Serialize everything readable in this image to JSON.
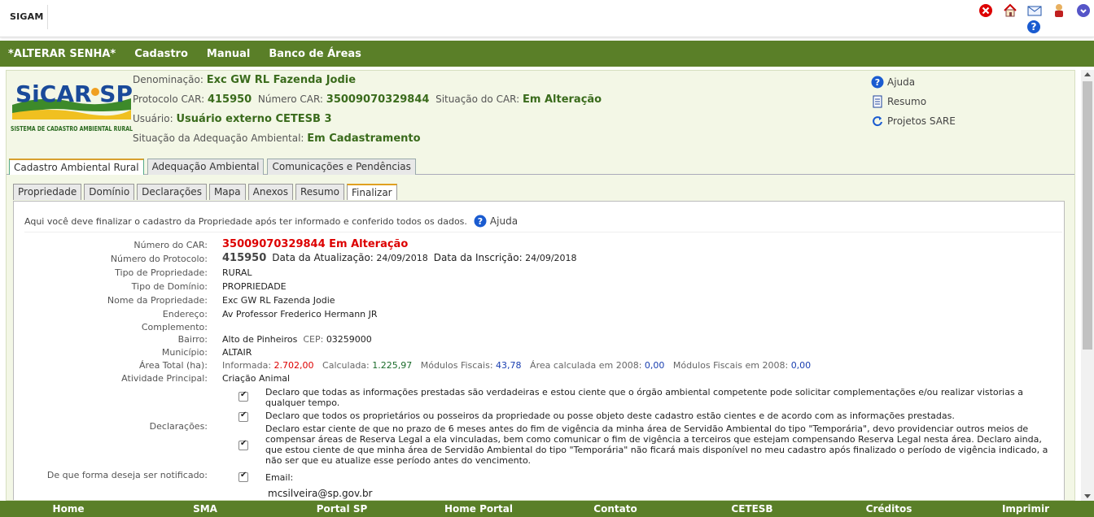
{
  "app": {
    "brand": "SIGAM"
  },
  "colors": {
    "nav_green": "#5a7f28",
    "value_green": "#3a6b1c",
    "alert_red": "#d00000",
    "link_blue": "#1a3fb0"
  },
  "top_icons": [
    {
      "name": "close-icon",
      "color": "#d00"
    },
    {
      "name": "home-icon",
      "color": "#c00"
    },
    {
      "name": "mail-icon",
      "color": "#2255aa"
    },
    {
      "name": "user-icon",
      "color": "#d08000"
    },
    {
      "name": "power-icon",
      "color": "#3a3aa0"
    }
  ],
  "mainnav": {
    "items": [
      "*ALTERAR SENHA*",
      "Cadastro",
      "Manual",
      "Banco de Áreas"
    ]
  },
  "header": {
    "logo_title": "SiCAR SP",
    "logo_subtitle": "SISTEMA DE CADASTRO AMBIENTAL RURAL",
    "denominacao_label": "Denominação:",
    "denominacao_value": "Exc GW RL Fazenda Jodie",
    "protocolo_label": "Protocolo CAR:",
    "protocolo_value": "415950",
    "numero_car_label": "Número CAR:",
    "numero_car_value": "35009070329844",
    "situacao_car_label": "Situação do CAR:",
    "situacao_car_value": "Em Alteração",
    "usuario_label": "Usuário:",
    "usuario_value": "Usuário externo CETESB 3",
    "adequacao_label": "Situação da Adequação Ambiental:",
    "adequacao_value": "Em Cadastramento"
  },
  "sidelinks": {
    "ajuda": "Ajuda",
    "resumo": "Resumo",
    "projetos": "Projetos SARE"
  },
  "outer_tabs": [
    "Cadastro Ambiental Rural",
    "Adequação Ambiental",
    "Comunicações e Pendências"
  ],
  "inner_tabs": [
    "Propriedade",
    "Domínio",
    "Declarações",
    "Mapa",
    "Anexos",
    "Resumo",
    "Finalizar"
  ],
  "intro": {
    "text": "Aqui você deve finalizar o cadastro da Propriedade após ter informado e conferido todos os dados.",
    "help": "Ajuda"
  },
  "details": {
    "numero_car_label": "Número do CAR:",
    "numero_car_value": "35009070329844 Em Alteração",
    "protocolo_label": "Número do Protocolo:",
    "protocolo_value": "415950",
    "data_atualizacao_label": "Data da Atualização:",
    "data_atualizacao_value": "24/09/2018",
    "data_inscricao_label": "Data da Inscrição:",
    "data_inscricao_value": "24/09/2018",
    "tipo_propriedade_label": "Tipo de Propriedade:",
    "tipo_propriedade_value": "RURAL",
    "tipo_dominio_label": "Tipo de Domínio:",
    "tipo_dominio_value": "PROPRIEDADE",
    "nome_label": "Nome da Propriedade:",
    "nome_value": "Exc GW RL Fazenda Jodie",
    "endereco_label": "Endereço:",
    "endereco_value": "Av Professor Frederico Hermann JR",
    "complemento_label": "Complemento:",
    "bairro_label": "Bairro:",
    "bairro_value": "Alto de Pinheiros",
    "cep_label": "CEP:",
    "cep_value": "03259000",
    "municipio_label": "Município:",
    "municipio_value": "ALTAIR",
    "area_label": "Área Total (ha):",
    "informada_label": "Informada:",
    "informada_value": "2.702,00",
    "calculada_label": "Calculada:",
    "calculada_value": "1.225,97",
    "modulos_label": "Módulos Fiscais:",
    "modulos_value": "43,78",
    "area2008_label": "Área calculada em 2008:",
    "area2008_value": "0,00",
    "modulos2008_label": "Módulos Fiscais em 2008:",
    "modulos2008_value": "0,00",
    "atividade_label": "Atividade Principal:",
    "atividade_value": "Criação Animal"
  },
  "declaracoes": {
    "label": "Declarações:",
    "items": [
      "Declaro que todas as informações prestadas são verdadeiras e estou ciente que o órgão ambiental competente pode solicitar complementações e/ou realizar vistorias a qualquer tempo.",
      "Declaro que todos os proprietários ou posseiros da propriedade ou posse objeto deste cadastro estão cientes e de acordo com as informações prestadas.",
      "Declaro estar ciente de que no prazo de 6 meses antes do fim de vigência da minha área de Servidão Ambiental do tipo \"Temporária\", devo providenciar outros meios de compensar áreas de Reserva Legal a ela vinculadas, bem como comunicar o fim de vigência a terceiros que estejam compensando Reserva Legal nesta área. Declaro ainda, que estou ciente de que minha área de Servidão Ambiental do tipo \"Temporária\" não ficará mais disponível no meu cadastro após finalizado o período de vigência indicado, a não ser que eu atualize esse período antes do vencimento."
    ]
  },
  "notificacao": {
    "label": "De que forma deseja ser notificado:",
    "email_label": "Email:",
    "email_value": "mcsilveira@sp.gov.br"
  },
  "footer": [
    "Home",
    "SMA",
    "Portal SP",
    "Home Portal",
    "Contato",
    "CETESB",
    "Créditos",
    "Imprimir"
  ]
}
